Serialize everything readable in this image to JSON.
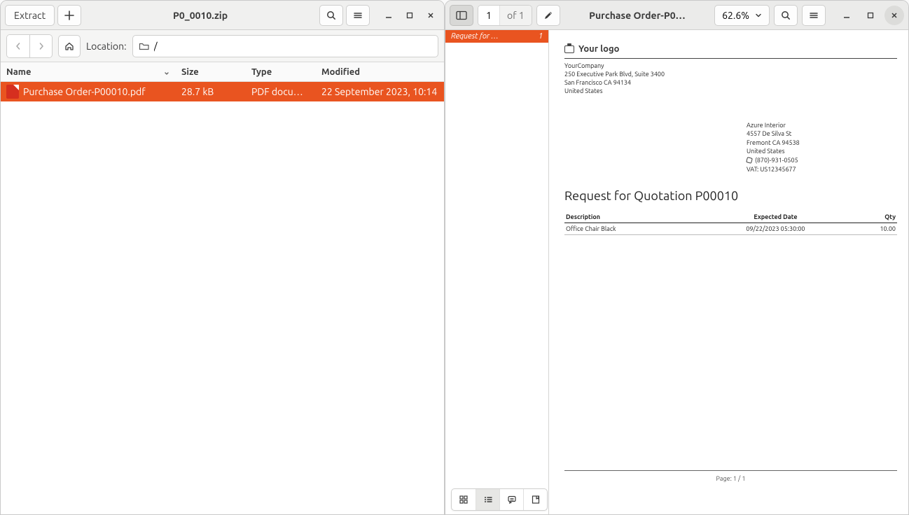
{
  "archive": {
    "extract_label": "Extract",
    "title": "P0_0010.zip",
    "location_label": "Location:",
    "location_value": "/",
    "columns": {
      "name": "Name",
      "size": "Size",
      "type": "Type",
      "modified": "Modified"
    },
    "files": [
      {
        "name": "Purchase Order-P00010.pdf",
        "size": "28.7 kB",
        "type": "PDF docum…",
        "modified": "22 September 2023, 10:14"
      }
    ]
  },
  "viewer": {
    "page_current": "1",
    "page_of": "of 1",
    "title": "Purchase Order-P0…",
    "zoom": "62.6%",
    "thumb_title": "Request for …",
    "thumb_page": "1"
  },
  "doc": {
    "logo_text": "Your logo",
    "company": {
      "name": "YourCompany",
      "addr1": "250 Executive Park Blvd, Suite 3400",
      "addr2": "San Francisco CA 94134",
      "country": "United States"
    },
    "vendor": {
      "name": "Azure Interior",
      "addr1": "4557 De Silva St",
      "addr2": "Fremont CA 94538",
      "country": "United States",
      "phone": "(870)-931-0505",
      "vat": "VAT: US12345677"
    },
    "rfq_title": "Request for Quotation P00010",
    "table": {
      "headers": {
        "description": "Description",
        "expected": "Expected Date",
        "qty": "Qty"
      },
      "rows": [
        {
          "description": "Office Chair Black",
          "expected": "09/22/2023 05:30:00",
          "qty": "10.00"
        }
      ]
    },
    "footer": "Page: 1 / 1"
  }
}
